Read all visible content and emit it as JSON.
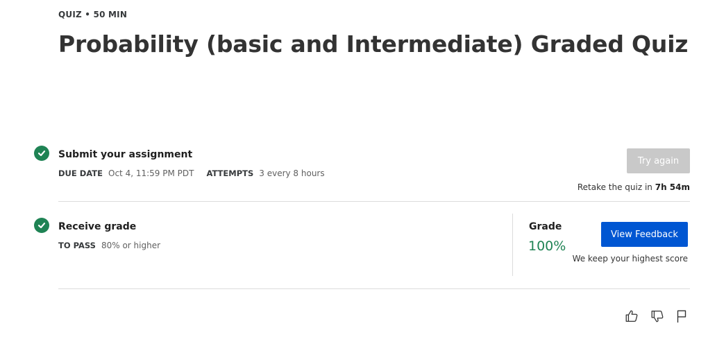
{
  "header": {
    "eyebrow": "QUIZ • 50 MIN",
    "title": "Probability (basic and Intermediate) Graded Quiz"
  },
  "submit": {
    "title": "Submit your assignment",
    "due_label": "DUE DATE",
    "due_value": "Oct 4, 11:59 PM PDT",
    "attempts_label": "ATTEMPTS",
    "attempts_value": "3 every 8 hours",
    "button_label": "Try again",
    "retake_text": "Retake the quiz in ",
    "retake_time": "7h 54m"
  },
  "receive": {
    "title": "Receive grade",
    "pass_label": "TO PASS",
    "pass_value": "80% or higher",
    "grade_label": "Grade",
    "grade_value": "100%",
    "button_label": "View Feedback",
    "note": "We keep your highest score"
  },
  "icons": {
    "step_status": "check-circle-icon",
    "feedback": [
      "thumbs-up-icon",
      "thumbs-down-icon",
      "flag-icon"
    ]
  },
  "colors": {
    "success": "#1f8354",
    "primary": "#0056d2",
    "disabled": "#c9c9c9"
  }
}
